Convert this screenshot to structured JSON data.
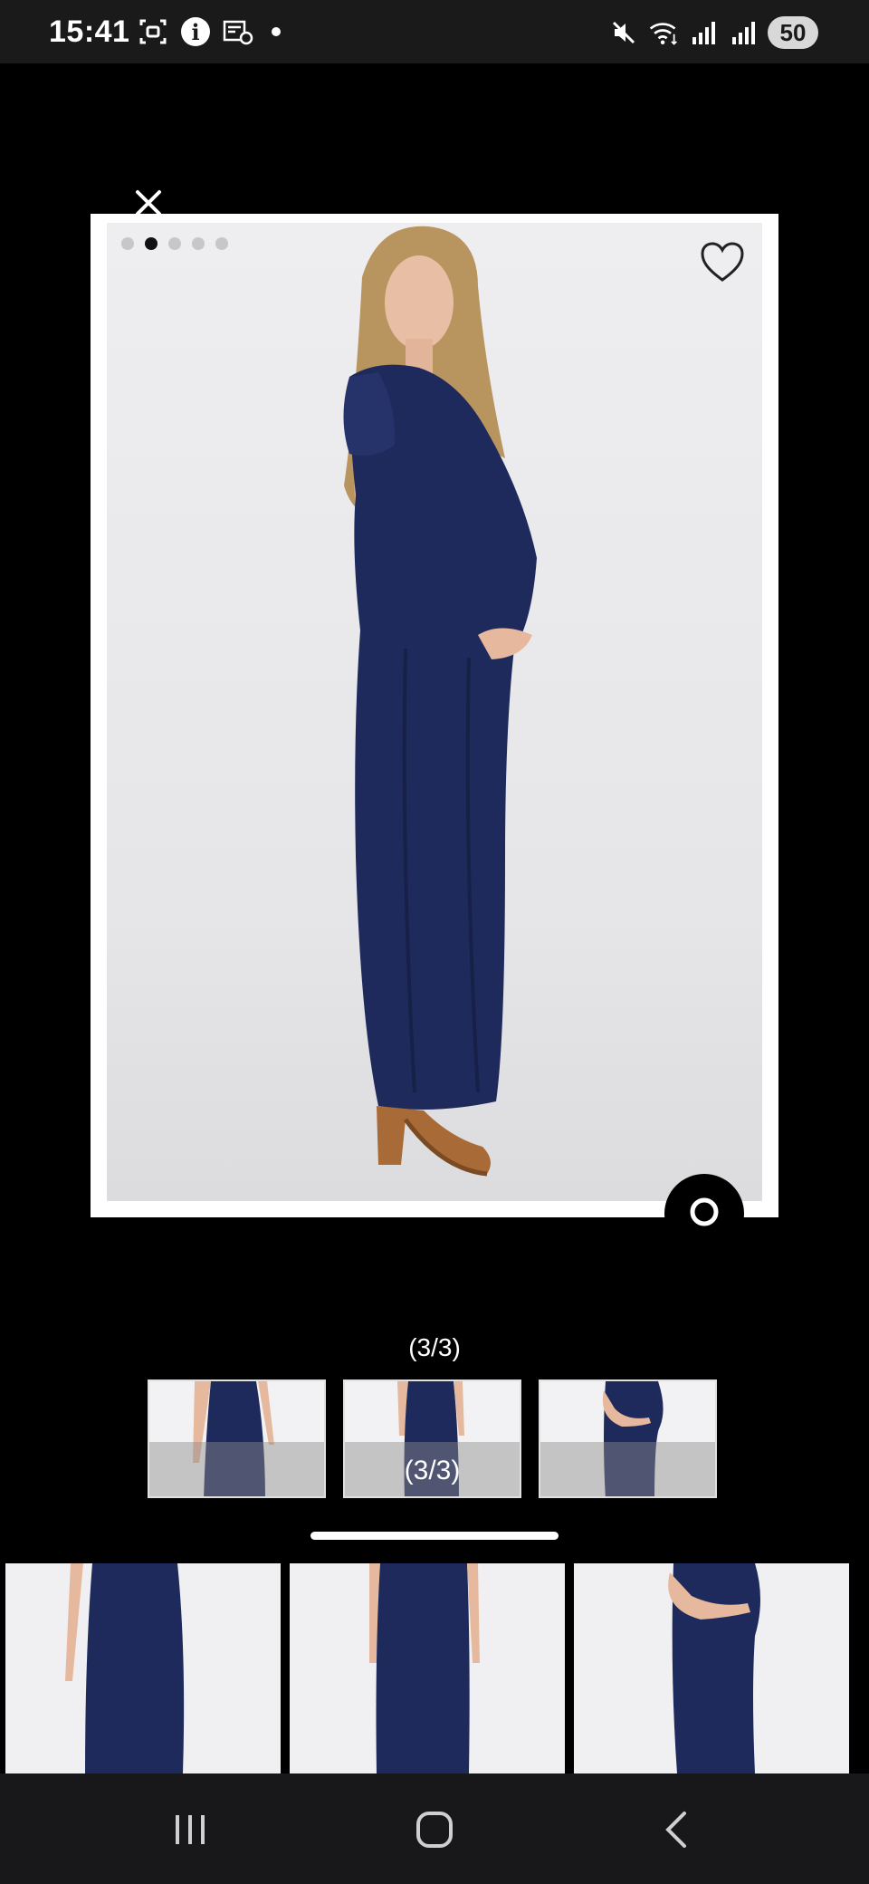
{
  "status_bar": {
    "time": "15:41",
    "left_icons": [
      "screenshot-icon",
      "info-icon",
      "sim-card-icon",
      "notification-dot-icon"
    ],
    "right_icons": [
      "mute-icon",
      "wifi-icon",
      "signal-icon",
      "signal-icon"
    ],
    "battery": "50"
  },
  "viewer": {
    "image_count": 5,
    "active_dot": 1,
    "product_color": "#1f2a5c"
  },
  "gallery": {
    "counter": "(3/3)",
    "thumbnail_overlay_label": "(3/3)",
    "thumbnails": [
      "back-view",
      "back-view",
      "side-view"
    ]
  },
  "bottom_strip": {
    "items": [
      "side-back-view",
      "back-view",
      "side-view"
    ]
  },
  "nav_bar": {
    "buttons": [
      "recent-apps-icon",
      "home-icon",
      "back-icon"
    ]
  },
  "colors": {
    "background": "#000000",
    "dress": "#1f2a5c",
    "status_bar": "#1a1a1a",
    "nav_bar": "#18181a"
  }
}
